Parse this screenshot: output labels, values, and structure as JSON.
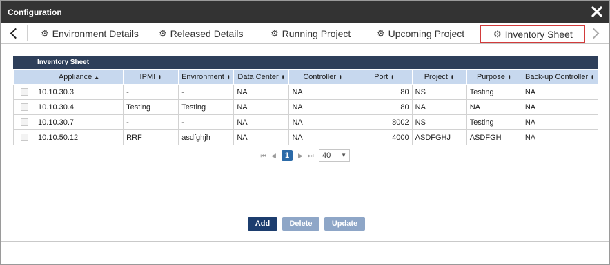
{
  "dialog": {
    "title": "Configuration"
  },
  "tabs": [
    {
      "label": "Environment Details",
      "icon": "gear-icon"
    },
    {
      "label": "Released Details",
      "icon": "gear-icon"
    },
    {
      "label": "Running Project",
      "icon": "gear-icon"
    },
    {
      "label": "Upcoming Project",
      "icon": "gear-icon"
    },
    {
      "label": "Inventory Sheet",
      "icon": "gear-icon",
      "active": true
    }
  ],
  "grid": {
    "caption": "Inventory Sheet",
    "columns": [
      {
        "label": "Appliance",
        "sort": "▲"
      },
      {
        "label": "IPMI",
        "sort": "⬍"
      },
      {
        "label": "Environment",
        "sort": "⬍"
      },
      {
        "label": "Data Center",
        "sort": "⬍"
      },
      {
        "label": "Controller",
        "sort": "⬍"
      },
      {
        "label": "Port",
        "sort": "⬍"
      },
      {
        "label": "Project",
        "sort": "⬍"
      },
      {
        "label": "Purpose",
        "sort": "⬍"
      },
      {
        "label": "Back-up Controller",
        "sort": "⬍"
      }
    ],
    "rows": [
      [
        "10.10.30.3",
        "-",
        "-",
        "NA",
        "NA",
        "80",
        "NS",
        "Testing",
        "NA"
      ],
      [
        "10.10.30.4",
        "Testing",
        "Testing",
        "NA",
        "NA",
        "80",
        "NA",
        "NA",
        "NA"
      ],
      [
        "10.10.30.7",
        "-",
        "-",
        "NA",
        "NA",
        "8002",
        "NS",
        "Testing",
        "NA"
      ],
      [
        "10.10.50.12",
        "RRF",
        "asdfghjh",
        "NA",
        "NA",
        "4000",
        "ASDFGHJ",
        "ASDFGH",
        "NA"
      ]
    ]
  },
  "pager": {
    "current_page": "1",
    "page_size": "40",
    "first": "⏮",
    "prev": "◀",
    "next": "▶",
    "last": "⏭"
  },
  "actions": {
    "add": "Add",
    "delete": "Delete",
    "update": "Update"
  },
  "colors": {
    "titlebar": "#333333",
    "grid_caption": "#2e3f5a",
    "header": "#c7d8ee",
    "primary_button": "#1c3d6e",
    "disabled_button": "#8ea6c7",
    "active_tab_border": "#d23b3b"
  }
}
